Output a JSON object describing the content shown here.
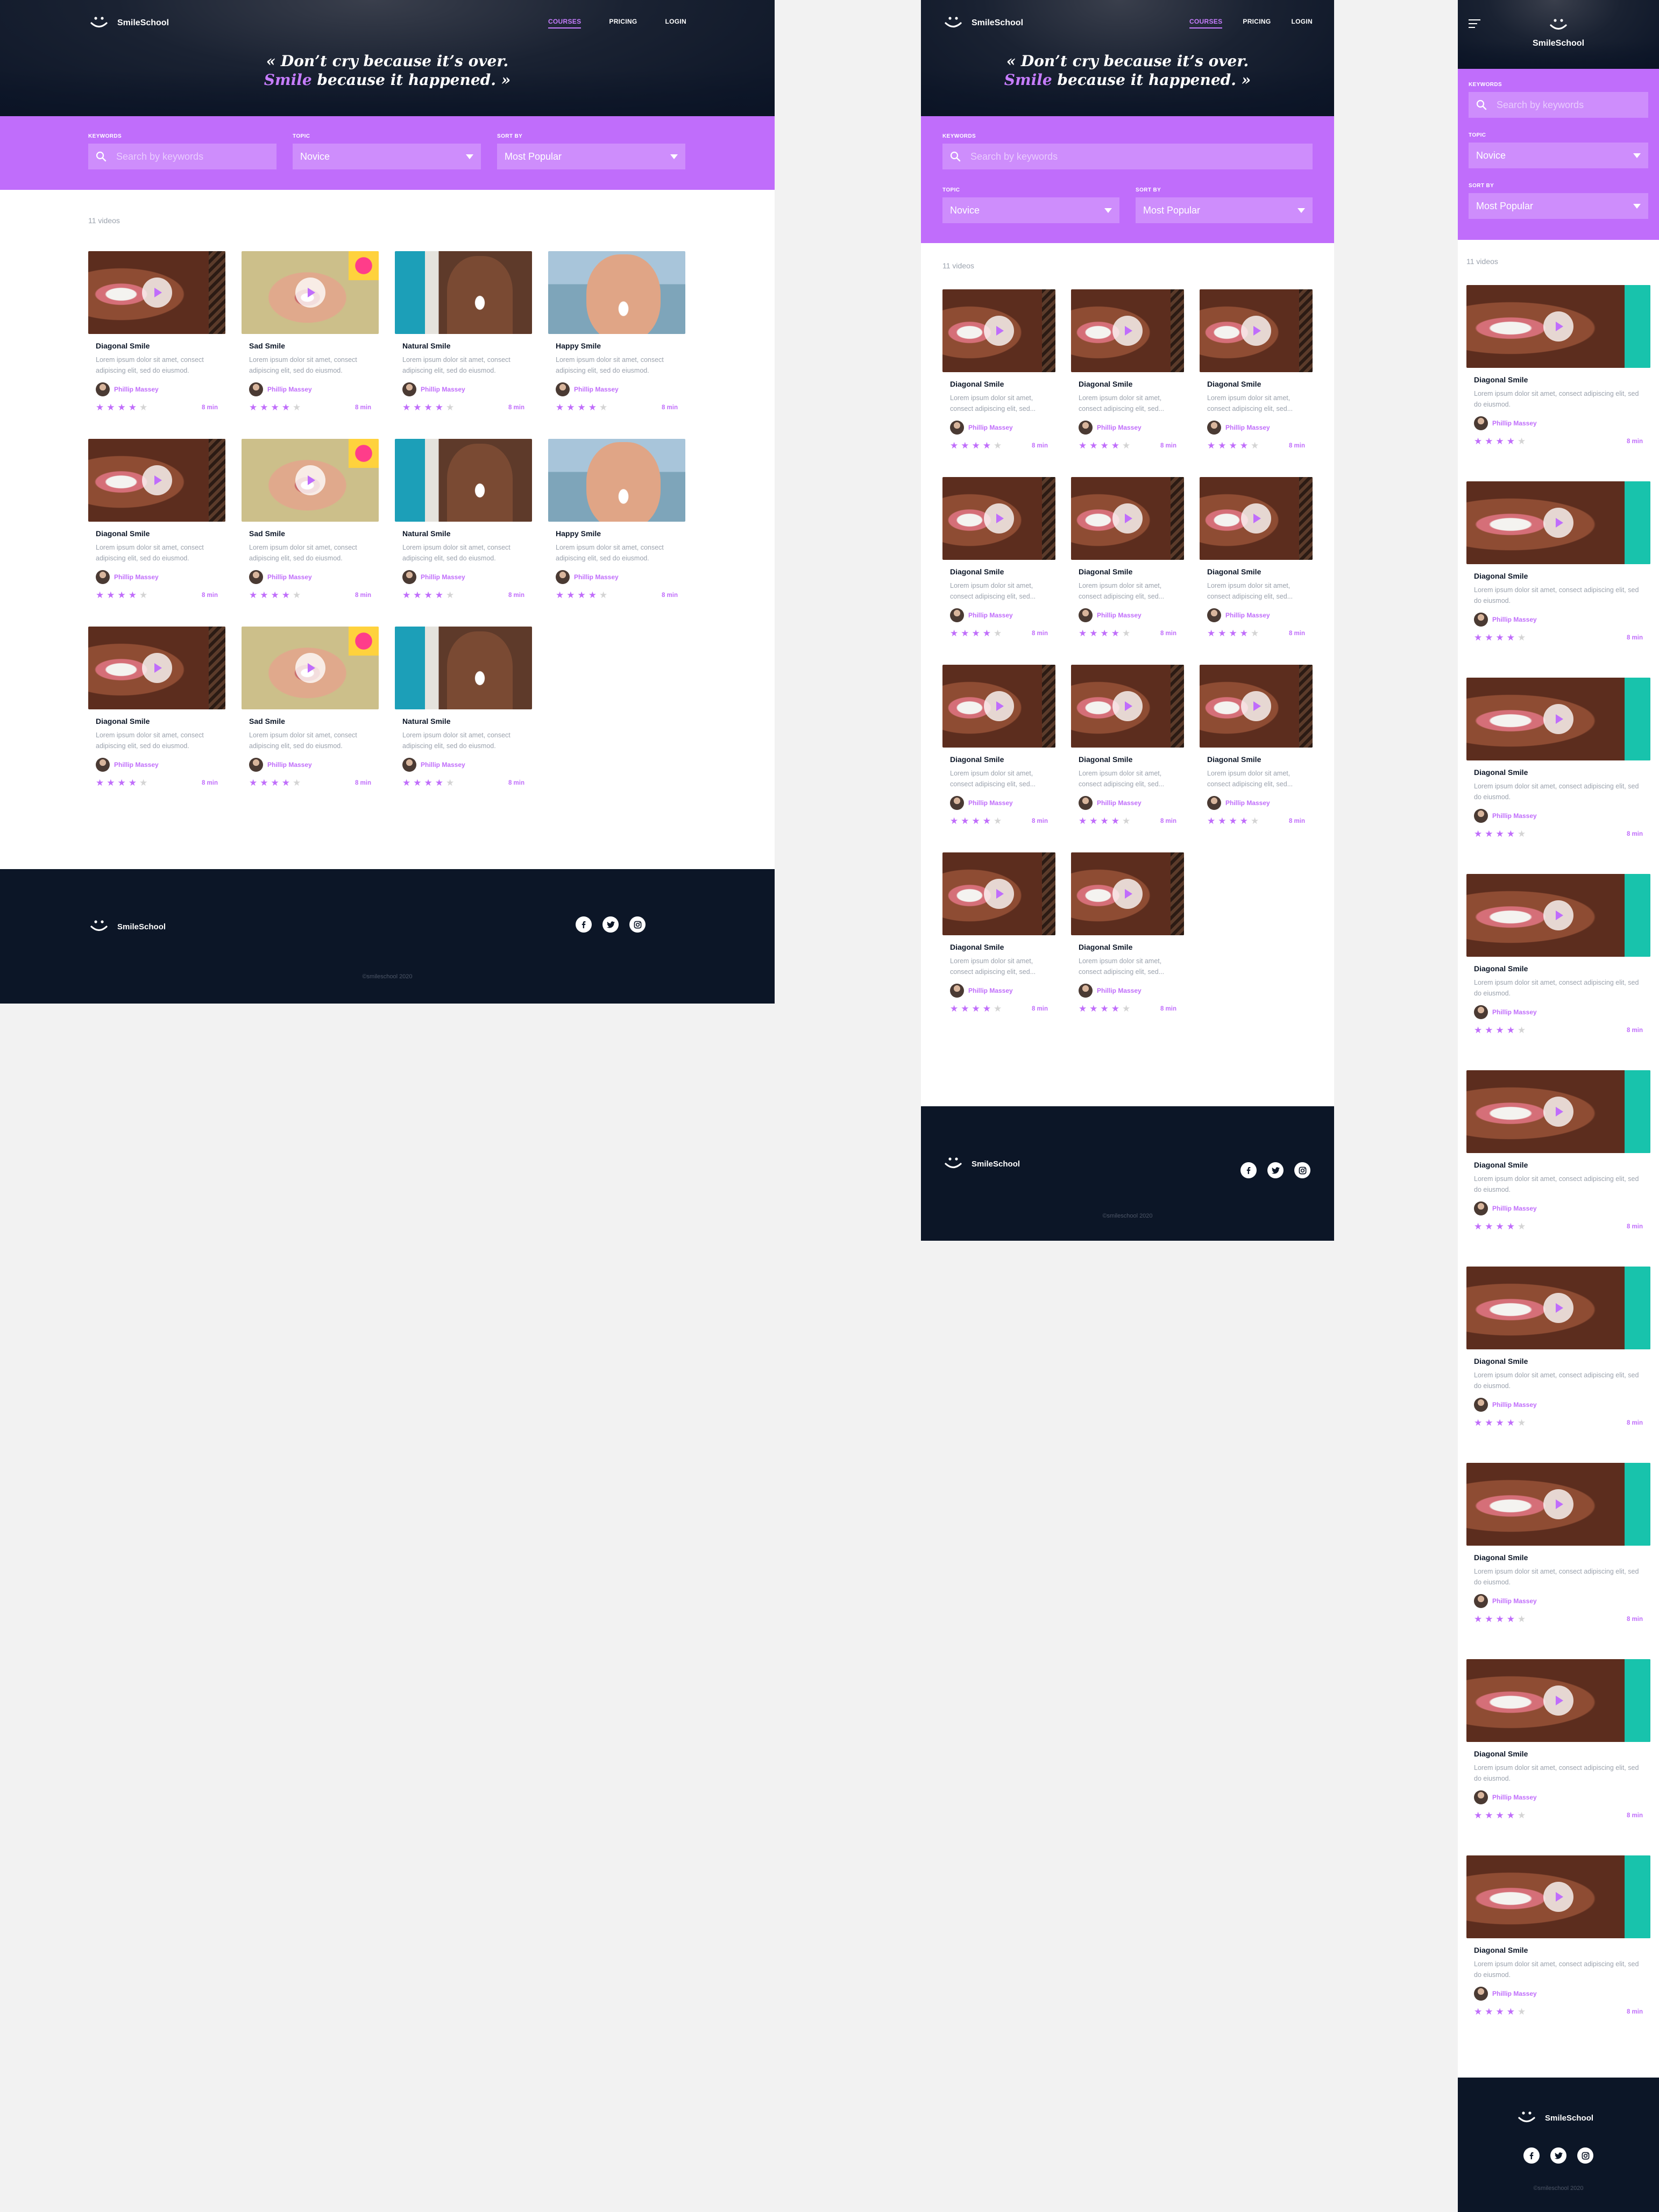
{
  "brand": {
    "name": "SmileSchool"
  },
  "nav": {
    "courses": "COURSES",
    "pricing": "PRICING",
    "login": "LOGIN"
  },
  "quote": {
    "line1": "« Don’t cry because it’s over.",
    "highlight": "Smile",
    "line2_rest": " because it happened. »"
  },
  "filters": {
    "keywords_label": "KEYWORDS",
    "search_placeholder": "Search by keywords",
    "topic_label": "TOPIC",
    "topic_value": "Novice",
    "sort_label": "SORT BY",
    "sort_value": "Most Popular"
  },
  "results": {
    "count": "11 videos"
  },
  "card": {
    "desc": "Lorem ipsum dolor sit amet, consect adipiscing elit, sed do eiusmod.",
    "desc_short": "Lorem ipsum dolor sit amet, consect adipiscing elit, sed...",
    "author": "Phillip Massey",
    "duration": "8 min",
    "rating": 4,
    "rating_max": 5
  },
  "desktop_cards": [
    {
      "title": "Diagonal Smile",
      "thumb": "t1"
    },
    {
      "title": "Sad Smile",
      "thumb": "t2"
    },
    {
      "title": "Natural Smile",
      "thumb": "t3"
    },
    {
      "title": "Happy Smile",
      "thumb": "t4"
    },
    {
      "title": "Diagonal Smile",
      "thumb": "t1"
    },
    {
      "title": "Sad Smile",
      "thumb": "t2"
    },
    {
      "title": "Natural Smile",
      "thumb": "t3"
    },
    {
      "title": "Happy Smile",
      "thumb": "t4"
    },
    {
      "title": "Diagonal Smile",
      "thumb": "t1"
    },
    {
      "title": "Sad Smile",
      "thumb": "t2"
    },
    {
      "title": "Natural Smile",
      "thumb": "t3"
    }
  ],
  "tablet_cards": [
    {
      "title": "Diagonal Smile"
    },
    {
      "title": "Diagonal Smile"
    },
    {
      "title": "Diagonal Smile"
    },
    {
      "title": "Diagonal Smile"
    },
    {
      "title": "Diagonal Smile"
    },
    {
      "title": "Diagonal Smile"
    },
    {
      "title": "Diagonal Smile"
    },
    {
      "title": "Diagonal Smile"
    },
    {
      "title": "Diagonal Smile"
    },
    {
      "title": "Diagonal Smile"
    },
    {
      "title": "Diagonal Smile"
    }
  ],
  "mobile_cards": [
    {
      "title": "Diagonal Smile"
    },
    {
      "title": "Diagonal Smile"
    },
    {
      "title": "Diagonal Smile"
    },
    {
      "title": "Diagonal Smile"
    },
    {
      "title": "Diagonal Smile"
    },
    {
      "title": "Diagonal Smile"
    },
    {
      "title": "Diagonal Smile"
    },
    {
      "title": "Diagonal Smile"
    },
    {
      "title": "Diagonal Smile"
    }
  ],
  "footer": {
    "copyright": "©smileschool 2020",
    "social": [
      "facebook-icon",
      "twitter-icon",
      "instagram-icon"
    ]
  },
  "colors": {
    "accent": "#c06dfb",
    "dark": "#0c1627",
    "teal": "#18c3ac"
  }
}
